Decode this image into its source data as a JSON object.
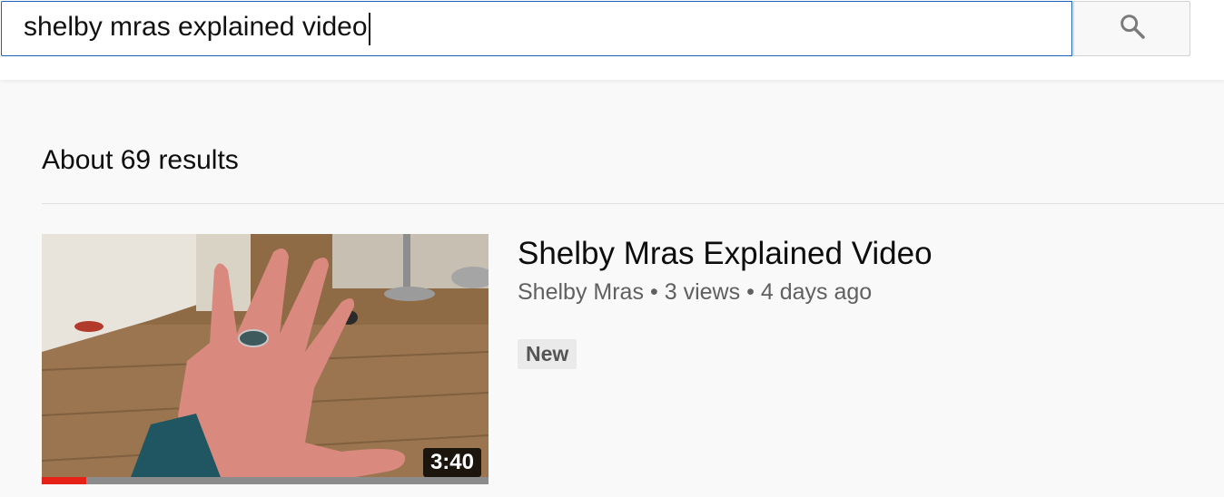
{
  "search": {
    "query": "shelby mras explained video",
    "button_icon": "search-icon"
  },
  "results": {
    "count_text": "About 69 results"
  },
  "video": {
    "title": "Shelby Mras Explained Video",
    "channel": "Shelby Mras",
    "views": "3 views",
    "age": "4 days ago",
    "separator": "•",
    "duration": "3:40",
    "badge": "New",
    "watched_fraction": 0.1,
    "thumbnail_subject": "hand with ring"
  },
  "colors": {
    "search_focus_border": "#1c62b9",
    "progress_fill": "#e62117",
    "page_background": "#f9f9f9"
  }
}
